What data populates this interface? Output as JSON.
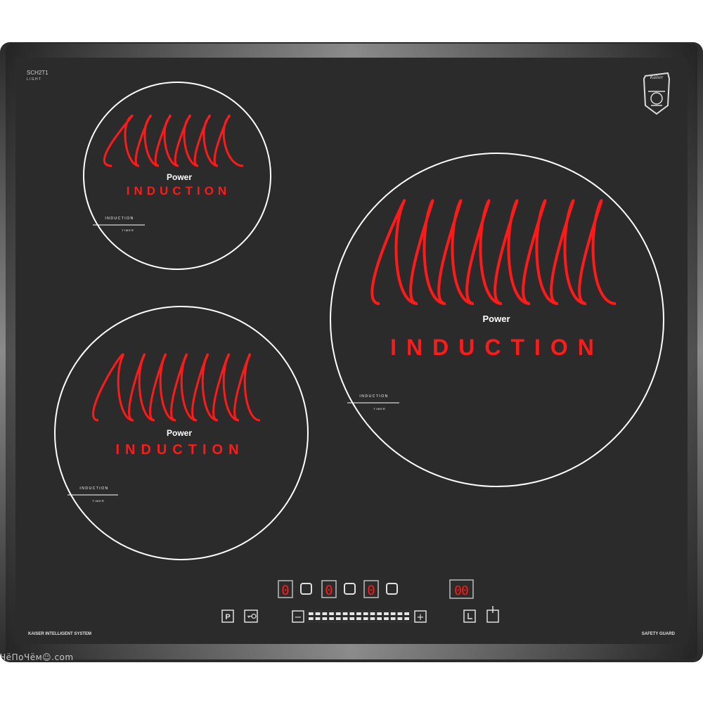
{
  "model": {
    "line1": "SCH2T1",
    "line2": "L I G H T"
  },
  "brand": {
    "logo_text": "Kaiser"
  },
  "zones": [
    {
      "id": "rear-left",
      "power_label": "Power",
      "induction_label": "INDUCTION",
      "tag_top": "INDUCTION",
      "tag_bottom": "TIMER"
    },
    {
      "id": "front-left",
      "power_label": "Power",
      "induction_label": "INDUCTION",
      "tag_top": "INDUCTION",
      "tag_bottom": "TIMER"
    },
    {
      "id": "right",
      "power_label": "Power",
      "induction_label": "INDUCTION",
      "tag_top": "INDUCTION",
      "tag_bottom": "TIMER"
    }
  ],
  "controls": {
    "pause_label": "P",
    "minus_label": "−",
    "plus_label": "+",
    "zone_displays": [
      "0",
      "0",
      "0"
    ],
    "timer_display": "00",
    "slider_segments": 15
  },
  "footer": {
    "left": "KAISER INTELLIGENT SYSTEM",
    "right": "SAFETY GUARD"
  },
  "watermark": "ЧёПоЧём☺.com",
  "colors": {
    "glass": "#2b2b2b",
    "frame": "#9a9a9a",
    "coil": "#ff1a1a",
    "ring": "#ffffff",
    "text_red": "#ff1a1a"
  }
}
